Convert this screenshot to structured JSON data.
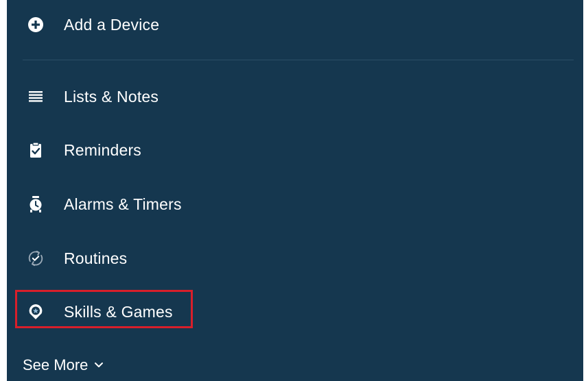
{
  "menu": {
    "add_device": {
      "label": "Add a Device",
      "icon": "plus-circle-icon"
    },
    "items": [
      {
        "label": "Lists & Notes",
        "icon": "list-icon"
      },
      {
        "label": "Reminders",
        "icon": "clipboard-check-icon"
      },
      {
        "label": "Alarms & Timers",
        "icon": "alarm-clock-icon"
      },
      {
        "label": "Routines",
        "icon": "routine-check-icon"
      },
      {
        "label": "Skills & Games",
        "icon": "skills-star-icon"
      }
    ],
    "see_more": {
      "label": "See More",
      "icon": "chevron-down-icon"
    }
  },
  "colors": {
    "background": "#15374f",
    "text": "#ffffff",
    "divider": "#2b4e66",
    "highlight": "#d81f2a"
  }
}
